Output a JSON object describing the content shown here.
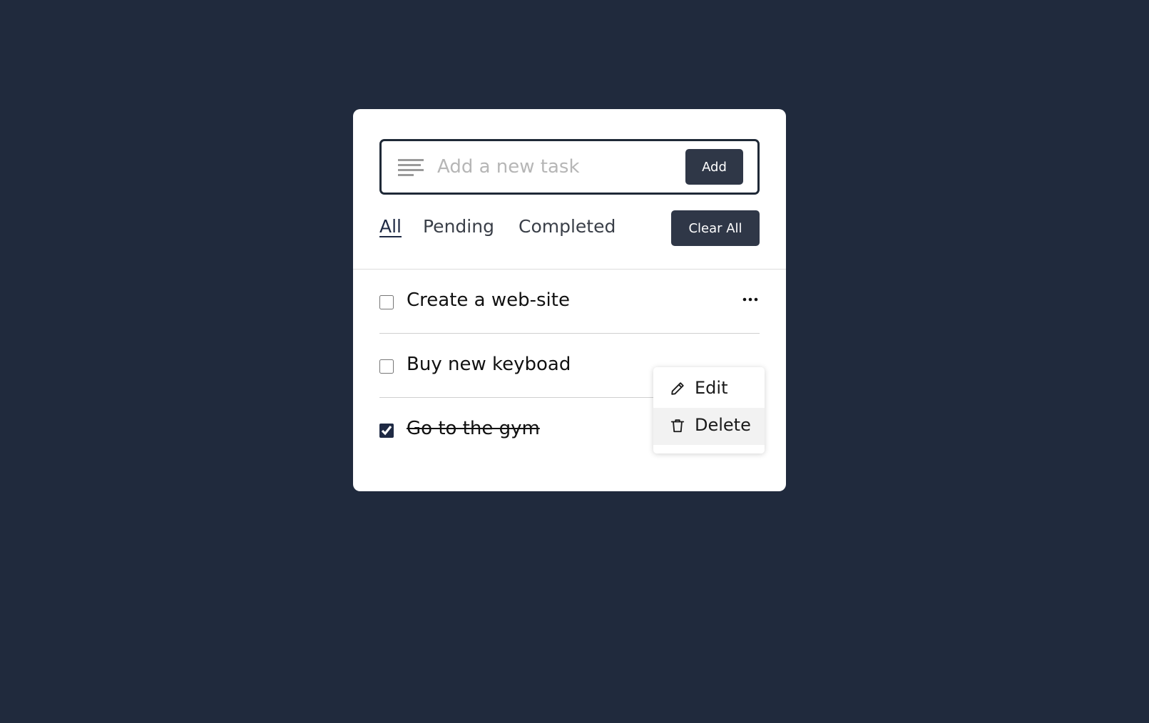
{
  "colors": {
    "background": "#202a3d",
    "card": "#ffffff",
    "button": "#2f3747",
    "input_border": "#1f2937"
  },
  "input": {
    "placeholder": "Add a new task",
    "value": "",
    "icon": "lines-icon",
    "add_label": "Add"
  },
  "filters": {
    "items": [
      {
        "label": "All",
        "active": true
      },
      {
        "label": "Pending",
        "active": false
      },
      {
        "label": "Completed",
        "active": false
      }
    ],
    "clear_label": "Clear All"
  },
  "tasks": [
    {
      "label": "Create a web-site",
      "checked": false
    },
    {
      "label": "Buy new keyboad",
      "checked": false
    },
    {
      "label": "Go to the gym",
      "checked": true
    }
  ],
  "task_menu": {
    "icon": "more-dots-icon",
    "items": [
      {
        "label": "Edit",
        "icon": "pencil-icon"
      },
      {
        "label": "Delete",
        "icon": "trash-icon"
      }
    ]
  }
}
